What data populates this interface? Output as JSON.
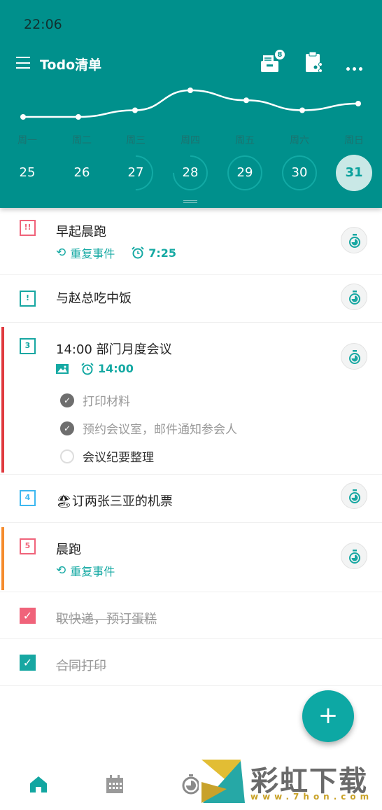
{
  "status_bar": {
    "time": "22:06"
  },
  "header": {
    "title": "Todo清单",
    "inbox_badge": "8",
    "accent": "#00908c"
  },
  "chart_data": {
    "type": "line",
    "categories": [
      "周一",
      "周二",
      "周三",
      "周四",
      "周五",
      "周六",
      "周日"
    ],
    "values": [
      0,
      0,
      1,
      4,
      2.5,
      1,
      2
    ],
    "grid": false
  },
  "days": [
    {
      "num": "25",
      "progress": 0
    },
    {
      "num": "26",
      "progress": 0
    },
    {
      "num": "27",
      "progress": 0.5
    },
    {
      "num": "28",
      "progress": 0.75
    },
    {
      "num": "29",
      "progress": 1
    },
    {
      "num": "30",
      "progress": 1
    },
    {
      "num": "31",
      "progress": 1,
      "selected": true
    }
  ],
  "tasks": [
    {
      "title": "早起晨跑",
      "priority": "!!",
      "color": "#f0637a",
      "repeat": "重复事件",
      "alarm": "7:25"
    },
    {
      "title": "与赵总吃中饭",
      "priority": "!",
      "color": "#17a7a2"
    },
    {
      "title": "14:00 部门月度会议",
      "priority": "3",
      "color": "#17a7a2",
      "alarm": "14:00",
      "bar": "#e0393e",
      "subtasks": [
        {
          "text": "打印材料",
          "done": true
        },
        {
          "text": "预约会议室，邮件通知参会人",
          "done": true
        },
        {
          "text": "会议纪要整理",
          "done": false
        }
      ]
    },
    {
      "title": "🏖订两张三亚的机票",
      "priority": "4",
      "color": "#3db8f0"
    },
    {
      "title": "晨跑",
      "priority": "5",
      "color": "#f0637a",
      "repeat": "重复事件",
      "bar": "#f58b2c"
    },
    {
      "title": "取快递，预订蛋糕",
      "done": true,
      "color": "#f0637a"
    },
    {
      "title": "合同打印",
      "done": true,
      "color": "#17a7a2"
    }
  ],
  "fab": {
    "label": "+"
  },
  "watermark": {
    "text": "彩虹下载",
    "url": "www.7hon.com"
  }
}
